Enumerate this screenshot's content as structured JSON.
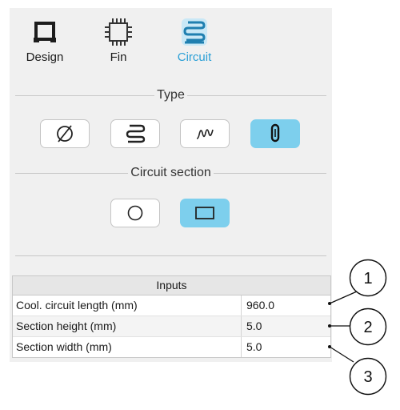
{
  "mode_tabs": [
    {
      "label": "Design",
      "icon": "design-frame-icon",
      "active": false
    },
    {
      "label": "Fin",
      "icon": "fin-chip-icon",
      "active": false
    },
    {
      "label": "Circuit",
      "icon": "circuit-coil-icon",
      "active": true
    }
  ],
  "type_section": {
    "title": "Type",
    "options": [
      {
        "icon": "none-diameter-icon",
        "selected": false
      },
      {
        "icon": "serpentine-icon",
        "selected": false
      },
      {
        "icon": "wave-icon",
        "selected": false
      },
      {
        "icon": "u-loop-icon",
        "selected": true
      }
    ]
  },
  "circuit_section": {
    "title": "Circuit section",
    "options": [
      {
        "icon": "circle-section-icon",
        "selected": false
      },
      {
        "icon": "rectangle-section-icon",
        "selected": true
      }
    ]
  },
  "inputs": {
    "title": "Inputs",
    "rows": [
      {
        "label": "Cool. circuit length (mm)",
        "value": "960.0"
      },
      {
        "label": "Section height (mm)",
        "value": "5.0"
      },
      {
        "label": "Section width (mm)",
        "value": "5.0"
      }
    ]
  },
  "callouts": [
    "1",
    "2",
    "3"
  ],
  "colors": {
    "accent": "#2a9fd6",
    "selected_fill": "#7dcfed",
    "panel": "#f0f0f0"
  }
}
